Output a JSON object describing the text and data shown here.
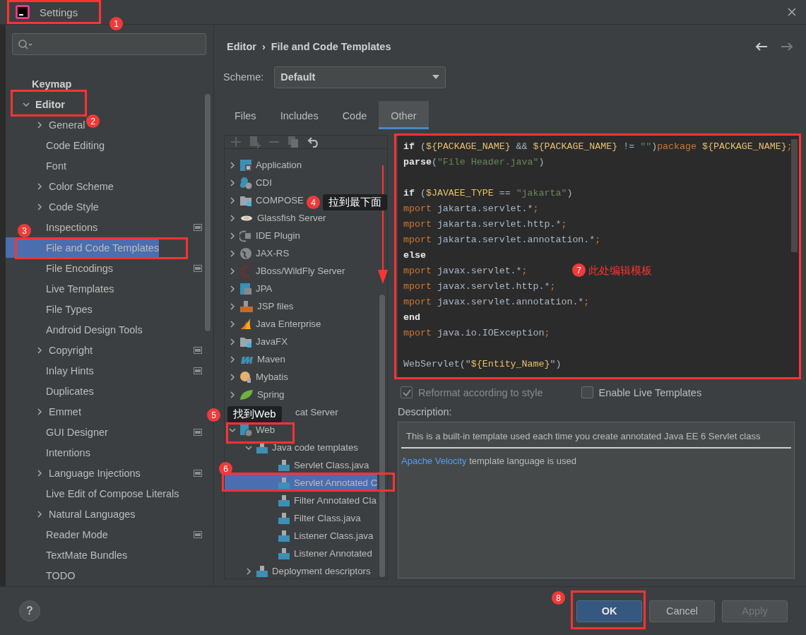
{
  "window": {
    "title": "Settings"
  },
  "sidebar": {
    "items": [
      {
        "label": "Keymap",
        "kind": "top",
        "selected": false
      },
      {
        "label": "Editor",
        "kind": "top-group",
        "expanded": true,
        "selected": false,
        "children": [
          {
            "label": "General",
            "kind": "group",
            "expanded": false,
            "project_scope": false,
            "selected": false
          },
          {
            "label": "Code Editing",
            "kind": "page",
            "project_scope": false,
            "selected": false
          },
          {
            "label": "Font",
            "kind": "page",
            "project_scope": false,
            "selected": false
          },
          {
            "label": "Color Scheme",
            "kind": "group",
            "expanded": false,
            "project_scope": false,
            "selected": false
          },
          {
            "label": "Code Style",
            "kind": "group",
            "expanded": false,
            "project_scope": false,
            "selected": false
          },
          {
            "label": "Inspections",
            "kind": "page",
            "project_scope": true,
            "selected": false
          },
          {
            "label": "File and Code Templates",
            "kind": "page",
            "project_scope": false,
            "selected": true
          },
          {
            "label": "File Encodings",
            "kind": "page",
            "project_scope": true,
            "selected": false
          },
          {
            "label": "Live Templates",
            "kind": "page",
            "project_scope": false,
            "selected": false
          },
          {
            "label": "File Types",
            "kind": "page",
            "project_scope": false,
            "selected": false
          },
          {
            "label": "Android Design Tools",
            "kind": "page",
            "project_scope": false,
            "selected": false
          },
          {
            "label": "Copyright",
            "kind": "group",
            "expanded": false,
            "project_scope": true,
            "selected": false
          },
          {
            "label": "Inlay Hints",
            "kind": "page",
            "project_scope": true,
            "selected": false
          },
          {
            "label": "Duplicates",
            "kind": "page",
            "project_scope": false,
            "selected": false
          },
          {
            "label": "Emmet",
            "kind": "group",
            "expanded": false,
            "project_scope": false,
            "selected": false
          },
          {
            "label": "GUI Designer",
            "kind": "page",
            "project_scope": true,
            "selected": false
          },
          {
            "label": "Intentions",
            "kind": "page",
            "project_scope": false,
            "selected": false
          },
          {
            "label": "Language Injections",
            "kind": "group",
            "expanded": false,
            "project_scope": true,
            "selected": false
          },
          {
            "label": "Live Edit of Compose Literals",
            "kind": "page",
            "project_scope": false,
            "selected": false
          },
          {
            "label": "Natural Languages",
            "kind": "group",
            "expanded": false,
            "project_scope": false,
            "selected": false
          },
          {
            "label": "Reader Mode",
            "kind": "page",
            "project_scope": true,
            "selected": false
          },
          {
            "label": "TextMate Bundles",
            "kind": "page",
            "project_scope": false,
            "selected": false
          },
          {
            "label": "TODO",
            "kind": "page",
            "project_scope": false,
            "selected": false
          }
        ]
      }
    ]
  },
  "breadcrumb": [
    "Editor",
    "›",
    "File and Code Templates"
  ],
  "scheme": {
    "label": "Scheme:",
    "value": "Default"
  },
  "tabs": [
    {
      "label": "Files",
      "selected": false
    },
    {
      "label": "Includes",
      "selected": false
    },
    {
      "label": "Code",
      "selected": false
    },
    {
      "label": "Other",
      "selected": true
    }
  ],
  "tree": [
    {
      "label": "Application",
      "kind": "node",
      "expanded": false,
      "selected": false
    },
    {
      "label": "CDI",
      "kind": "node",
      "expanded": false,
      "selected": false
    },
    {
      "label": "COMPOSE",
      "kind": "node",
      "expanded": false,
      "selected": false
    },
    {
      "label": "Glassfish Server",
      "kind": "node",
      "expanded": false,
      "selected": false
    },
    {
      "label": "IDE Plugin",
      "kind": "node",
      "expanded": false,
      "selected": false
    },
    {
      "label": "JAX-RS",
      "kind": "node",
      "expanded": false,
      "selected": false
    },
    {
      "label": "JBoss/WildFly Server",
      "kind": "node",
      "expanded": false,
      "selected": false
    },
    {
      "label": "JPA",
      "kind": "node",
      "expanded": false,
      "selected": false
    },
    {
      "label": "JSP files",
      "kind": "node",
      "expanded": false,
      "selected": false
    },
    {
      "label": "Java Enterprise",
      "kind": "node",
      "expanded": false,
      "selected": false
    },
    {
      "label": "JavaFX",
      "kind": "node",
      "expanded": false,
      "selected": false
    },
    {
      "label": "Maven",
      "kind": "node",
      "expanded": false,
      "selected": false
    },
    {
      "label": "Mybatis",
      "kind": "node",
      "expanded": false,
      "selected": false
    },
    {
      "label": "Spring",
      "kind": "node",
      "expanded": false,
      "selected": false
    },
    {
      "label": "cat Server",
      "kind": "covered",
      "selected": false
    },
    {
      "label": "Web",
      "kind": "node",
      "expanded": true,
      "selected": false,
      "children": [
        {
          "label": "Java code templates",
          "kind": "node",
          "expanded": true,
          "selected": false,
          "children": [
            {
              "label": "Servlet Class.java",
              "kind": "leaf",
              "selected": false
            },
            {
              "label": "Servlet Annotated C",
              "kind": "leaf",
              "selected": true
            },
            {
              "label": "Filter Annotated Cla",
              "kind": "leaf",
              "selected": false
            },
            {
              "label": "Filter Class.java",
              "kind": "leaf",
              "selected": false
            },
            {
              "label": "Listener Class.java",
              "kind": "leaf",
              "selected": false
            },
            {
              "label": "Listener Annotated",
              "kind": "leaf",
              "selected": false
            }
          ]
        },
        {
          "label": "Deployment descriptors",
          "kind": "node",
          "expanded": false,
          "selected": false
        }
      ]
    }
  ],
  "code": [
    {
      "kind": "code",
      "tokens": [
        {
          "t": "if",
          "kind": "directive"
        },
        {
          "t": " (",
          "kind": "plain"
        },
        {
          "t": "${PACKAGE_NAME}",
          "kind": "var"
        },
        {
          "t": " && ",
          "kind": "plain"
        },
        {
          "t": "${PACKAGE_NAME}",
          "kind": "var"
        },
        {
          "t": " != ",
          "kind": "plain"
        },
        {
          "t": "\"\"",
          "kind": "string"
        },
        {
          "t": ")",
          "kind": "plain"
        },
        {
          "t": "package ",
          "kind": "keyword"
        },
        {
          "t": "${PACKAGE_NAME}",
          "kind": "var"
        },
        {
          "t": ";",
          "kind": "keyword"
        }
      ]
    },
    {
      "kind": "code",
      "tokens": [
        {
          "t": "parse",
          "kind": "directive"
        },
        {
          "t": "(",
          "kind": "plain"
        },
        {
          "t": "\"File Header.java\"",
          "kind": "string"
        },
        {
          "t": ")",
          "kind": "plain"
        }
      ]
    },
    {
      "kind": "blank"
    },
    {
      "kind": "code",
      "tokens": [
        {
          "t": "if",
          "kind": "directive"
        },
        {
          "t": " (",
          "kind": "plain"
        },
        {
          "t": "$JAVAEE_TYPE",
          "kind": "var"
        },
        {
          "t": " == ",
          "kind": "plain"
        },
        {
          "t": "\"jakarta\"",
          "kind": "string"
        },
        {
          "t": ")",
          "kind": "plain"
        }
      ]
    },
    {
      "kind": "code",
      "tokens": [
        {
          "t": "mport",
          "kind": "keyword"
        },
        {
          "t": " jakarta.servlet.*",
          "kind": "plain"
        },
        {
          "t": ";",
          "kind": "keyword"
        }
      ]
    },
    {
      "kind": "code",
      "tokens": [
        {
          "t": "mport",
          "kind": "keyword"
        },
        {
          "t": " jakarta.servlet.http.*",
          "kind": "plain"
        },
        {
          "t": ";",
          "kind": "keyword"
        }
      ]
    },
    {
      "kind": "code",
      "tokens": [
        {
          "t": "mport",
          "kind": "keyword"
        },
        {
          "t": " jakarta.servlet.annotation.*",
          "kind": "plain"
        },
        {
          "t": ";",
          "kind": "keyword"
        }
      ]
    },
    {
      "kind": "code",
      "tokens": [
        {
          "t": "else",
          "kind": "directive"
        }
      ]
    },
    {
      "kind": "code",
      "tokens": [
        {
          "t": "mport",
          "kind": "keyword"
        },
        {
          "t": " javax.servlet.*",
          "kind": "plain"
        },
        {
          "t": ";",
          "kind": "keyword"
        }
      ]
    },
    {
      "kind": "code",
      "tokens": [
        {
          "t": "mport",
          "kind": "keyword"
        },
        {
          "t": " javax.servlet.http.*",
          "kind": "plain"
        },
        {
          "t": ";",
          "kind": "keyword"
        }
      ]
    },
    {
      "kind": "code",
      "tokens": [
        {
          "t": "mport",
          "kind": "keyword"
        },
        {
          "t": " javax.servlet.annotation.*",
          "kind": "plain"
        },
        {
          "t": ";",
          "kind": "keyword"
        }
      ]
    },
    {
      "kind": "code",
      "tokens": [
        {
          "t": "end",
          "kind": "directive"
        }
      ]
    },
    {
      "kind": "code",
      "tokens": [
        {
          "t": "mport",
          "kind": "keyword"
        },
        {
          "t": " java.io.IOException",
          "kind": "plain"
        },
        {
          "t": ";",
          "kind": "keyword"
        }
      ]
    },
    {
      "kind": "blank"
    },
    {
      "kind": "code",
      "tokens": [
        {
          "t": "WebServlet(\"",
          "kind": "plain"
        },
        {
          "t": "${Entity_Name}",
          "kind": "var"
        },
        {
          "t": "\")",
          "kind": "plain"
        }
      ]
    }
  ],
  "options": [
    {
      "label": "Reformat according to style",
      "checked": true,
      "disabled": true
    },
    {
      "label": "Enable Live Templates",
      "checked": false,
      "disabled": false
    }
  ],
  "description": {
    "label": "Description:",
    "text": "This is a built-in template used each time you create annotated Java EE 6 Servlet class",
    "link": "Apache Velocity",
    "link_suffix": " template language is used"
  },
  "buttons": [
    {
      "label": "OK",
      "kind": "primary",
      "disabled": false
    },
    {
      "label": "Cancel",
      "kind": "normal",
      "disabled": false
    },
    {
      "label": "Apply",
      "kind": "normal",
      "disabled": true
    }
  ],
  "help": "?",
  "annotations": [
    {
      "number": "1",
      "kind": "badge"
    },
    {
      "number": "2",
      "kind": "badge"
    },
    {
      "number": "3",
      "kind": "badge"
    },
    {
      "number": "4",
      "kind": "bubble",
      "note": "拉到最下面"
    },
    {
      "number": "5",
      "kind": "bubble",
      "note": "找到Web"
    },
    {
      "number": "6",
      "kind": "badge"
    },
    {
      "number": "7",
      "kind": "plain",
      "note": "此处编辑模板"
    },
    {
      "number": "8",
      "kind": "badge"
    }
  ]
}
